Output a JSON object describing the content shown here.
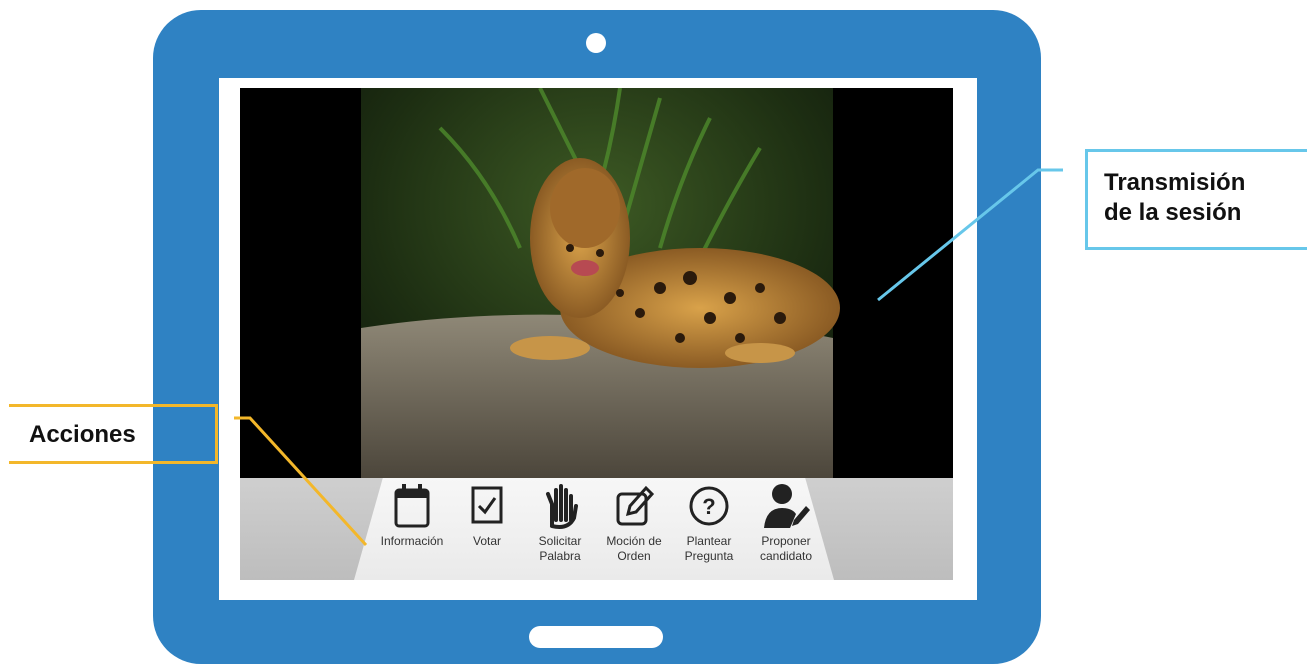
{
  "callouts": {
    "stream_label": "Transmisión\nde la sesión",
    "actions_label": "Acciones"
  },
  "actions": [
    {
      "label": "Información",
      "icon": "calendar-icon"
    },
    {
      "label": "Votar",
      "icon": "checkbox-icon"
    },
    {
      "label": "Solicitar\nPalabra",
      "icon": "raised-hand-icon"
    },
    {
      "label": "Moción de\nOrden",
      "icon": "edit-icon"
    },
    {
      "label": "Plantear\nPregunta",
      "icon": "question-icon"
    },
    {
      "label": "Proponer\ncandidato",
      "icon": "user-edit-icon"
    }
  ],
  "colors": {
    "tablet": "#2f82c3",
    "stream_callout": "#67c7ea",
    "actions_callout": "#f3b72a"
  },
  "video": {
    "subject": "jaguar-photo"
  }
}
